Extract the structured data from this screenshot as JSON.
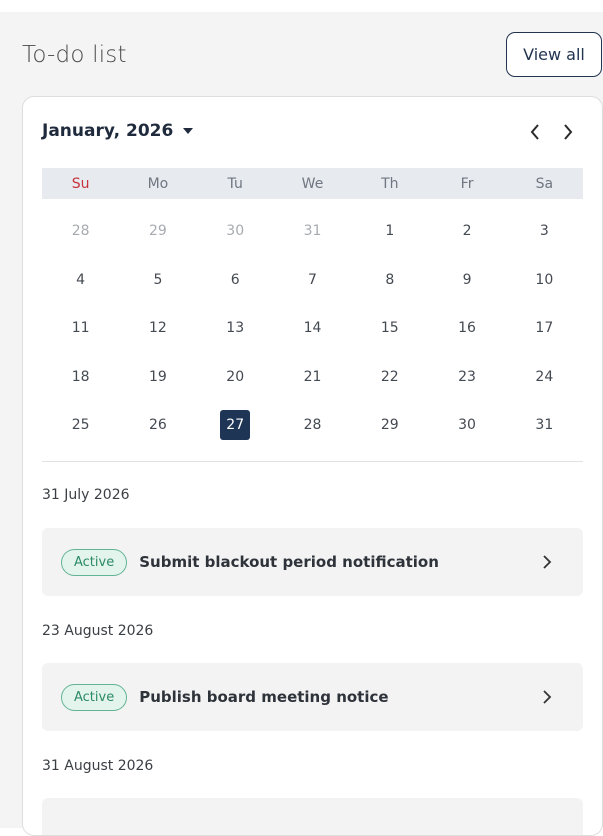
{
  "header": {
    "title": "To-do list",
    "view_all_label": "View all"
  },
  "calendar": {
    "month_label": "January, 2026",
    "weekdays": [
      "Su",
      "Mo",
      "Tu",
      "We",
      "Th",
      "Fr",
      "Sa"
    ],
    "weeks": [
      [
        "28",
        "29",
        "30",
        "31",
        "1",
        "2",
        "3"
      ],
      [
        "4",
        "5",
        "6",
        "7",
        "8",
        "9",
        "10"
      ],
      [
        "11",
        "12",
        "13",
        "14",
        "15",
        "16",
        "17"
      ],
      [
        "18",
        "19",
        "20",
        "21",
        "22",
        "23",
        "24"
      ],
      [
        "25",
        "26",
        "27",
        "28",
        "29",
        "30",
        "31"
      ]
    ],
    "muted_days": [
      "28",
      "29",
      "30",
      "31"
    ],
    "selected_day": "27"
  },
  "groups": [
    {
      "date": "31 July 2026",
      "tasks": [
        {
          "status": "Active",
          "title": "Submit blackout period notification"
        }
      ]
    },
    {
      "date": "23 August 2026",
      "tasks": [
        {
          "status": "Active",
          "title": "Publish board meeting notice"
        }
      ]
    },
    {
      "date": "31 August 2026",
      "tasks": []
    }
  ],
  "colors": {
    "accent": "#1e3556",
    "sunday": "#c8323b",
    "badge_border": "#62b394",
    "badge_bg": "#e2f4ec",
    "badge_text": "#2c8a64"
  },
  "icons": {
    "month_dropdown": "caret-down-icon",
    "prev": "chevron-left-icon",
    "next": "chevron-right-icon",
    "task_open": "chevron-right-icon"
  }
}
